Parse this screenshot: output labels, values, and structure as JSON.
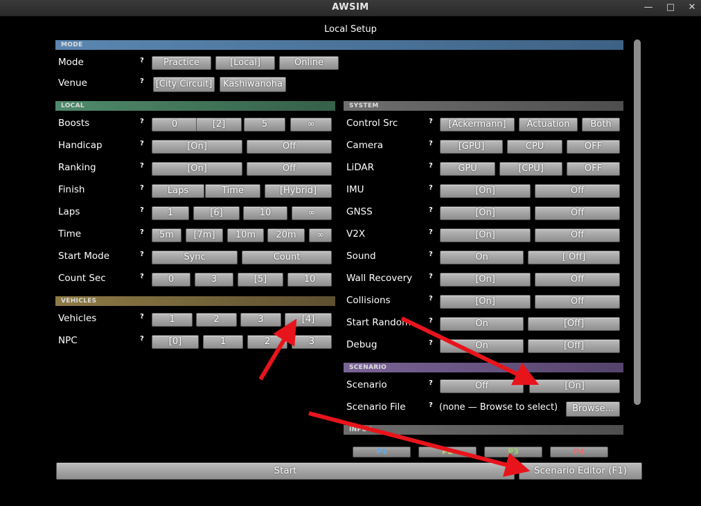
{
  "window": {
    "title": "AWSIM"
  },
  "page_title": "Local Setup",
  "sections": {
    "mode": "MODE",
    "local": "LOCAL",
    "vehicles": "VEHICLES",
    "system": "SYSTEM",
    "scenario": "SCENARIO",
    "input": "INPUT"
  },
  "colors": {
    "mode": "#4a6f94",
    "local": "#3f6e59",
    "vehicles": "#6b5b35",
    "system": "#5c5c5c",
    "scenario": "#5b4a75",
    "input": "#5c5c5c",
    "arrow": "#e8141c",
    "p1": "#5fa8e8",
    "p2": "#c8d060",
    "p3": "#9ad06a",
    "p4": "#e07070"
  },
  "help": "?",
  "mode": {
    "label": "Mode",
    "options": [
      "Practice",
      "[Local]",
      "Online"
    ]
  },
  "venue": {
    "label": "Venue",
    "options": [
      "[City Circuit]",
      "Kashiwanoha"
    ]
  },
  "local": {
    "boosts": {
      "label": "Boosts",
      "options": [
        "0",
        "[2]",
        "5",
        "∞"
      ]
    },
    "handicap": {
      "label": "Handicap",
      "options": [
        "[On]",
        "Off"
      ]
    },
    "ranking": {
      "label": "Ranking",
      "options": [
        "[On]",
        "Off"
      ]
    },
    "finish": {
      "label": "Finish",
      "options": [
        "Laps",
        "Time",
        "[Hybrid]"
      ]
    },
    "laps": {
      "label": "Laps",
      "options": [
        "1",
        "[6]",
        "10",
        "∞"
      ]
    },
    "time": {
      "label": "Time",
      "options": [
        "5m",
        "[7m]",
        "10m",
        "20m",
        "∞"
      ]
    },
    "start_mode": {
      "label": "Start Mode",
      "options": [
        "Sync",
        "Count"
      ]
    },
    "count_sec": {
      "label": "Count Sec",
      "options": [
        "0",
        "3",
        "[5]",
        "10"
      ]
    }
  },
  "vehicles": {
    "vehicles": {
      "label": "Vehicles",
      "options": [
        "1",
        "2",
        "3",
        "[4]"
      ]
    },
    "npc": {
      "label": "NPC",
      "options": [
        "[0]",
        "1",
        "2",
        "3"
      ]
    }
  },
  "system": {
    "control_src": {
      "label": "Control Src",
      "options": [
        "[Ackermann]",
        "Actuation",
        "Both"
      ]
    },
    "camera": {
      "label": "Camera",
      "options": [
        "[GPU]",
        "CPU",
        "OFF"
      ]
    },
    "lidar": {
      "label": "LiDAR",
      "options": [
        "GPU",
        "[CPU]",
        "OFF"
      ]
    },
    "imu": {
      "label": "IMU",
      "options": [
        "[On]",
        "Off"
      ]
    },
    "gnss": {
      "label": "GNSS",
      "options": [
        "[On]",
        "Off"
      ]
    },
    "v2x": {
      "label": "V2X",
      "options": [
        "[On]",
        "Off"
      ]
    },
    "sound": {
      "label": "Sound",
      "options": [
        "On",
        "[ Off]"
      ]
    },
    "wall_recovery": {
      "label": "Wall Recovery",
      "options": [
        "[On]",
        "Off"
      ]
    },
    "collisions": {
      "label": "Collisions",
      "options": [
        "[On]",
        "Off"
      ]
    },
    "start_random": {
      "label": "Start Random",
      "options": [
        "On",
        "[Off]"
      ]
    },
    "debug": {
      "label": "Debug",
      "options": [
        "On",
        "[Off]"
      ]
    }
  },
  "scenario": {
    "scenario": {
      "label": "Scenario",
      "options": [
        "Off",
        "[On]"
      ]
    },
    "scenario_file": {
      "label": "Scenario File",
      "value": "(none — Browse to select)",
      "browse": "Browse..."
    }
  },
  "input": {
    "players": [
      "P1",
      "P2",
      "P3",
      "P4"
    ]
  },
  "footer": {
    "start": "Start",
    "scenario_editor": "Scenario Editor (F1)"
  }
}
